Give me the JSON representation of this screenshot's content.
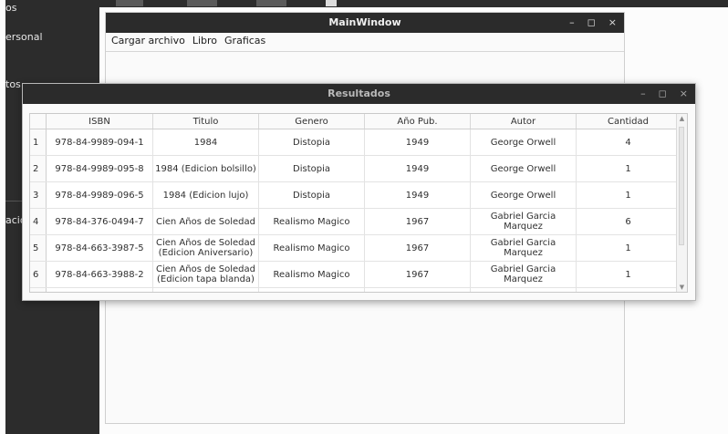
{
  "desktop": {
    "labels": [
      "os",
      "ersonal",
      "tos",
      "acio"
    ]
  },
  "main_window": {
    "title": "MainWindow",
    "controls": {
      "minimize": "–",
      "maximize": "◻",
      "close": "×"
    },
    "menu": [
      "Cargar archivo",
      "Libro",
      "Graficas"
    ]
  },
  "dialog": {
    "title": "Resultados",
    "controls": {
      "minimize": "–",
      "maximize": "◻",
      "close": "×"
    },
    "table": {
      "headers": [
        "ISBN",
        "Titulo",
        "Genero",
        "Año Pub.",
        "Autor",
        "Cantidad"
      ],
      "rows": [
        {
          "num": "1",
          "isbn": "978-84-9989-094-1",
          "titulo": "1984",
          "genero": "Distopia",
          "anio": "1949",
          "autor": "George Orwell",
          "cantidad": "4"
        },
        {
          "num": "2",
          "isbn": "978-84-9989-095-8",
          "titulo": "1984 (Edicion bolsillo)",
          "genero": "Distopia",
          "anio": "1949",
          "autor": "George Orwell",
          "cantidad": "1"
        },
        {
          "num": "3",
          "isbn": "978-84-9989-096-5",
          "titulo": "1984 (Edicion lujo)",
          "genero": "Distopia",
          "anio": "1949",
          "autor": "George Orwell",
          "cantidad": "1"
        },
        {
          "num": "4",
          "isbn": "978-84-376-0494-7",
          "titulo": "Cien Años de Soledad",
          "genero": "Realismo Magico",
          "anio": "1967",
          "autor": "Gabriel Garcia Marquez",
          "cantidad": "6"
        },
        {
          "num": "5",
          "isbn": "978-84-663-3987-5",
          "titulo": "Cien Años de Soledad (Edicion Aniversario)",
          "genero": "Realismo Magico",
          "anio": "1967",
          "autor": "Gabriel Garcia Marquez",
          "cantidad": "1"
        },
        {
          "num": "6",
          "isbn": "978-84-663-3988-2",
          "titulo": "Cien Años de Soledad (Edicion tapa blanda)",
          "genero": "Realismo Magico",
          "anio": "1967",
          "autor": "Gabriel Garcia Marquez",
          "cantidad": "1"
        }
      ]
    }
  }
}
